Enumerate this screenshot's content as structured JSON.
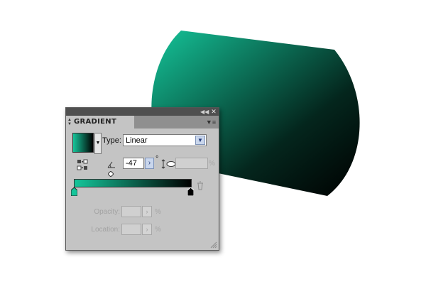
{
  "colors": {
    "gradient_start": "#15c59a",
    "gradient_end": "#000000"
  },
  "panel": {
    "collapse_icon": "double-chevron-left-icon",
    "close_icon": "close-x-icon",
    "tab_label": "GRADIENT",
    "menu_icon": "panel-menu-icon",
    "type_label": "Type:",
    "type_value": "Linear",
    "angle_value": "-47",
    "degree_sign": "°",
    "aspect_value": "",
    "aspect_unit": "%",
    "opacity_label": "Opacity:",
    "opacity_value": "",
    "opacity_unit": "%",
    "location_label": "Location:",
    "location_value": "",
    "location_unit": "%"
  }
}
